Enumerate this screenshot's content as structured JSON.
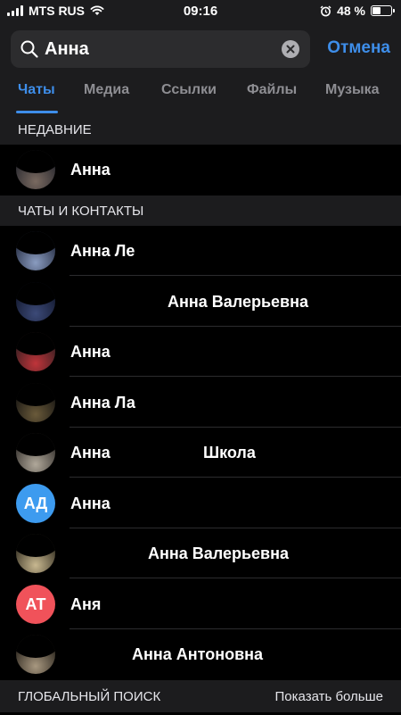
{
  "status_bar": {
    "carrier": "MTS RUS",
    "time": "09:16",
    "battery_percent": "48 %",
    "battery_level": 0.48
  },
  "search": {
    "value": "Анна",
    "cancel_label": "Отмена"
  },
  "tabs": [
    {
      "label": "Чаты",
      "active": true
    },
    {
      "label": "Медиа",
      "active": false
    },
    {
      "label": "Ссылки",
      "active": false
    },
    {
      "label": "Файлы",
      "active": false
    },
    {
      "label": "Музыка",
      "active": false
    }
  ],
  "sections": {
    "recent": "НЕДАВНИЕ",
    "chats_contacts": "ЧАТЫ И КОНТАКТЫ",
    "global_search": "ГЛОБАЛЬНЫЙ ПОИСК",
    "show_more": "Показать больше"
  },
  "recent": [
    {
      "name": "Анна",
      "avatar": "photo"
    }
  ],
  "results": [
    {
      "name": "Анна Ле",
      "avatar": "photo"
    },
    {
      "name": "Анна Валерьевна",
      "avatar": "photo"
    },
    {
      "name": "Анна",
      "avatar": "photo"
    },
    {
      "name": "Анна Ла",
      "avatar": "photo"
    },
    {
      "name": "Анна",
      "name_suffix": "Школа",
      "avatar": "photo"
    },
    {
      "name": "Анна",
      "avatar": "initials",
      "initials": "АД",
      "color": "#3d9bef"
    },
    {
      "name": "Анна Валерьевна",
      "avatar": "photo"
    },
    {
      "name": "Аня",
      "avatar": "initials",
      "initials": "АТ",
      "color": "#f0525a"
    },
    {
      "name": "Анна Антоновна",
      "avatar": "photo"
    }
  ],
  "colors": {
    "accent": "#3e8eea",
    "background": "#000000",
    "header_bg": "#1c1c1e"
  }
}
